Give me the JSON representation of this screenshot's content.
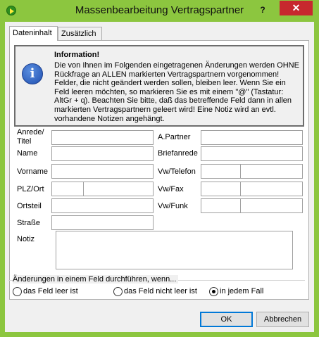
{
  "window": {
    "title": "Massenbearbeitung Vertragspartner",
    "help_label": "?",
    "close_label": "✕"
  },
  "tabs": [
    {
      "label": "Dateninhalt",
      "active": true
    },
    {
      "label": "Zusätzlich",
      "active": false
    }
  ],
  "info": {
    "heading": "Information!",
    "text": "Die von Ihnen im Folgenden eingetragenen Änderungen werden OHNE Rückfrage an ALLEN markierten Vertragspartnern vorgenommen! Felder, die nicht geändert werden sollen, bleiben leer. Wenn Sie ein Feld leeren möchten, so markieren Sie es mit einem \"@\" (Tastatur: AltGr + q). Beachten Sie bitte, daß das betreffende  Feld dann in allen markierten Vertragspartnern geleert wird! Eine Notiz wird an evtl. vorhandene Notizen angehängt.",
    "icon": "info-icon"
  },
  "fields": {
    "anrede_titel": {
      "label": "Anrede/ Titel",
      "value": ""
    },
    "name": {
      "label": "Name",
      "value": ""
    },
    "vorname": {
      "label": "Vorname",
      "value": ""
    },
    "plz_ort": {
      "label": "PLZ/Ort",
      "plz": "",
      "ort": ""
    },
    "ortsteil": {
      "label": "Ortsteil",
      "value": ""
    },
    "strasse": {
      "label": "Straße",
      "value": ""
    },
    "notiz": {
      "label": "Notiz",
      "value": ""
    },
    "a_partner": {
      "label": "A.Partner",
      "value": ""
    },
    "briefanrede": {
      "label": "Briefanrede",
      "value": ""
    },
    "vw_telefon": {
      "label": "Vw/Telefon",
      "vorwahl": "",
      "nummer": ""
    },
    "vw_fax": {
      "label": "Vw/Fax",
      "vorwahl": "",
      "nummer": ""
    },
    "vw_funk": {
      "label": "Vw/Funk",
      "vorwahl": "",
      "nummer": ""
    }
  },
  "change_mode": {
    "title": "Änderungen in einem Feld durchführen, wenn...",
    "options": [
      {
        "label": "das Feld leer ist",
        "checked": false
      },
      {
        "label": "das Feld nicht leer ist",
        "checked": false
      },
      {
        "label": "in jedem Fall",
        "checked": true
      }
    ]
  },
  "buttons": {
    "ok": "OK",
    "cancel": "Abbrechen"
  },
  "colors": {
    "title_bar": "#8cc63f",
    "close_button": "#c7282e",
    "default_button_border": "#0078d7"
  }
}
